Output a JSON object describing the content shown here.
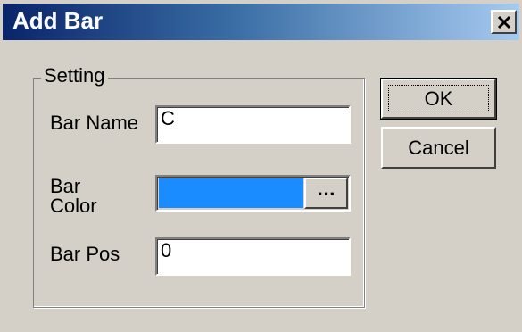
{
  "window": {
    "title": "Add Bar",
    "close_icon": "close-icon"
  },
  "group": {
    "label": "Setting"
  },
  "fields": {
    "bar_name": {
      "label": "Bar Name",
      "value": "C"
    },
    "bar_color": {
      "label": "Bar\nColor",
      "color": "#1a8cff",
      "button_label": "..."
    },
    "bar_pos": {
      "label": "Bar Pos",
      "value": "0"
    }
  },
  "buttons": {
    "ok": "OK",
    "cancel": "Cancel"
  },
  "colors": {
    "title_gradient_start": "#0a246a",
    "face": "#d4d0c8"
  }
}
